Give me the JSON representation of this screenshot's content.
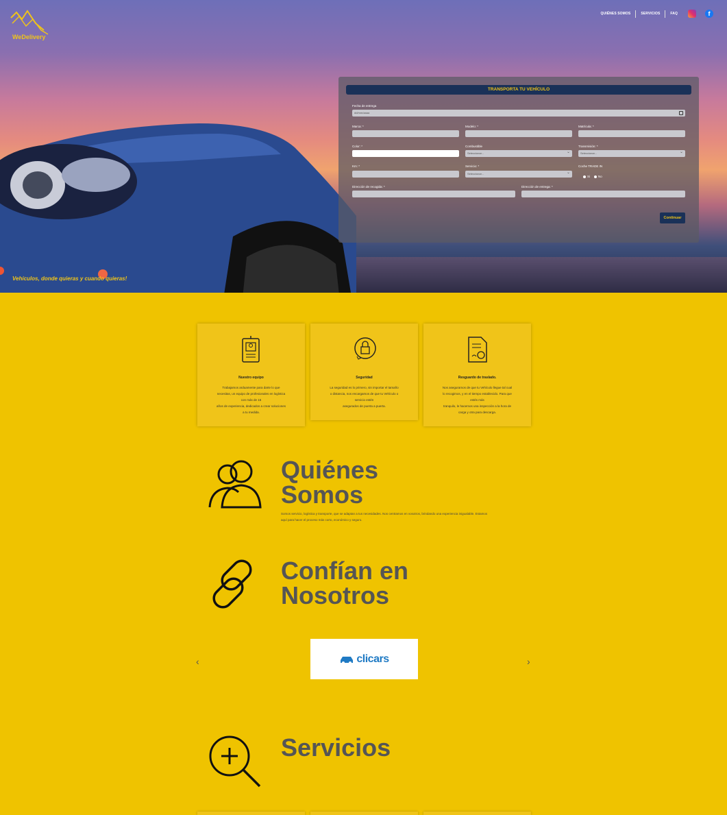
{
  "brand": {
    "name": "WeDelivery",
    "tagline": "Vehículos, donde quieras y cuando quieras!"
  },
  "nav": {
    "items": [
      "QUIÉNES SOMOS",
      "SERVICIOS",
      "FAQ"
    ]
  },
  "social": {
    "facebook_glyph": "f"
  },
  "colors": {
    "accent": "#f0c419",
    "navy": "#1a3158",
    "page_bg": "#efc300"
  },
  "form": {
    "title": "TRANSPORTA TU VEHÍCULO",
    "fecha_label": "Fecha de entrega",
    "fecha_value": "dd/mm/aaaa",
    "marca_label": "Marca: *",
    "modelo_label": "Modelo: *",
    "matricula_label": "Matrícula: *",
    "color_label": "Color: *",
    "combustible_label": "Combustible",
    "transmision_label": "Transmisión: *",
    "km_label": "Km: *",
    "servicio_label": "Servicio: *",
    "trade_in_label": "Coche TRADE IN",
    "select_placeholder": "Seleccionar...",
    "radio_yes": "Si",
    "radio_no": "No",
    "recogida_label": "Dirección de recogida: *",
    "entrega_label": "Dirección de entrega: *",
    "submit_label": "Continuar"
  },
  "features": [
    {
      "title": "Nuestro equipo",
      "desc": "Trabajamos arduamente para darte lo que\nnecesitas, un equipo de profesionales en logística\ncon más de 15\naños de experiencia, dedicados a crear soluciones\na tu medida."
    },
    {
      "title": "Seguridad",
      "desc": "La seguridad es lo primero, sin importar el tamaño\no distancia, nos encargamos de que tu Vehículo o\nservicio estén\nasegurados de puerta a puerta."
    },
    {
      "title": "Resguardo de traslado.",
      "desc": "Nos aseguramos de que tu Vehículo llegue tal cual\nlo recogimos, y en el tiempo establecido. Para que\nestés más\ntranquilo, le hacemos una inspección a la hora de\ncarga y otra para descarga."
    }
  ],
  "about": {
    "title": "Quiénes\nSomos",
    "text": "Somos servicio, logística y transporte, que se adaptan a tus necesidades. Nos centramos en vosotros, brindando una experiencia inigualable. Estamos aquí para hacer el proceso más corto, económico y seguro."
  },
  "trust": {
    "title": "Confían en\nNosotros",
    "partner": "clicars",
    "prev": "‹",
    "next": "›"
  },
  "services": {
    "title": "Servicios"
  }
}
